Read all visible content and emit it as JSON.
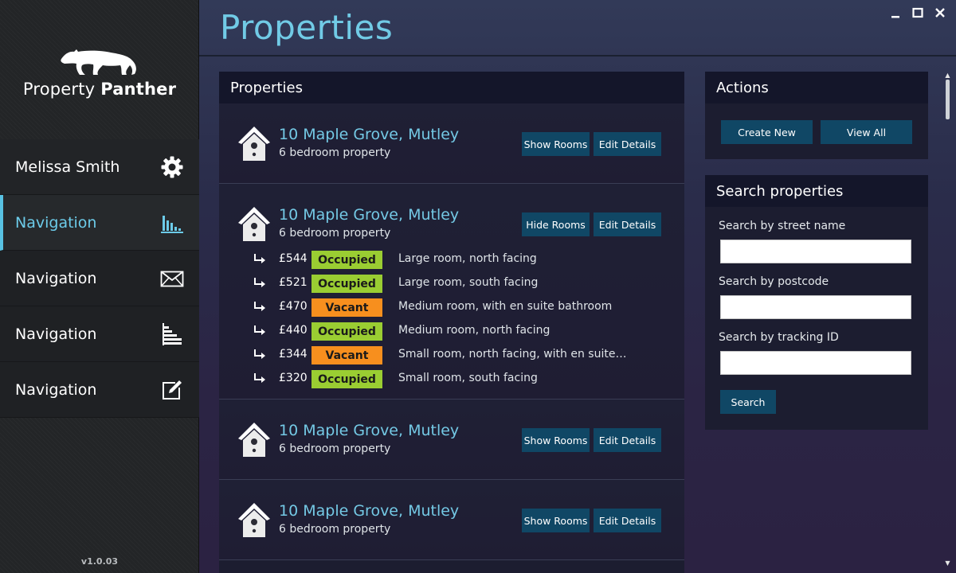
{
  "sidebar": {
    "brand_light": "Property",
    "brand_bold": "Panther",
    "user": {
      "name": "Melissa Smith",
      "icon": "gear-icon"
    },
    "items": [
      {
        "label": "Navigation",
        "icon": "bar-chart-icon",
        "active": true
      },
      {
        "label": "Navigation",
        "icon": "mail-icon",
        "active": false
      },
      {
        "label": "Navigation",
        "icon": "horizontal-bar-chart-icon",
        "active": false
      },
      {
        "label": "Navigation",
        "icon": "edit-icon",
        "active": false
      }
    ],
    "version": "v1.0.03"
  },
  "page": {
    "title": "Properties"
  },
  "window_controls": [
    "minimize-icon",
    "maximize-icon",
    "close-icon"
  ],
  "properties_panel": {
    "title": "Properties",
    "items": [
      {
        "address": "10 Maple Grove, Mutley",
        "subtitle": "6 bedroom property",
        "rooms_button": "Show Rooms",
        "edit_button": "Edit Details",
        "expanded": false
      },
      {
        "address": "10 Maple Grove, Mutley",
        "subtitle": "6 bedroom property",
        "rooms_button": "Hide Rooms",
        "edit_button": "Edit Details",
        "expanded": true,
        "rooms": [
          {
            "price": "£544",
            "status": "Occupied",
            "description": "Large room, north facing"
          },
          {
            "price": "£521",
            "status": "Occupied",
            "description": "Large room, south facing"
          },
          {
            "price": "£470",
            "status": "Vacant",
            "description": "Medium room, with en suite bathroom"
          },
          {
            "price": "£440",
            "status": "Occupied",
            "description": "Medium room, north facing"
          },
          {
            "price": "£344",
            "status": "Vacant",
            "description": "Small room, north facing, with en suite bath..."
          },
          {
            "price": "£320",
            "status": "Occupied",
            "description": "Small room, south facing"
          }
        ]
      },
      {
        "address": "10 Maple Grove, Mutley",
        "subtitle": "6 bedroom property",
        "rooms_button": "Show Rooms",
        "edit_button": "Edit Details",
        "expanded": false
      },
      {
        "address": "10 Maple Grove, Mutley",
        "subtitle": "6 bedroom property",
        "rooms_button": "Show Rooms",
        "edit_button": "Edit Details",
        "expanded": false
      }
    ]
  },
  "actions_panel": {
    "title": "Actions",
    "create_label": "Create New",
    "view_all_label": "View All"
  },
  "search_panel": {
    "title": "Search properties",
    "street_label": "Search by street name",
    "street_value": "",
    "postcode_label": "Search by postcode",
    "postcode_value": "",
    "tracking_label": "Search by tracking ID",
    "tracking_value": "",
    "search_label": "Search"
  },
  "colors": {
    "accent": "#6ccbe9",
    "button": "#104765",
    "occupied": "#9acd32",
    "vacant": "#f78f1e"
  }
}
